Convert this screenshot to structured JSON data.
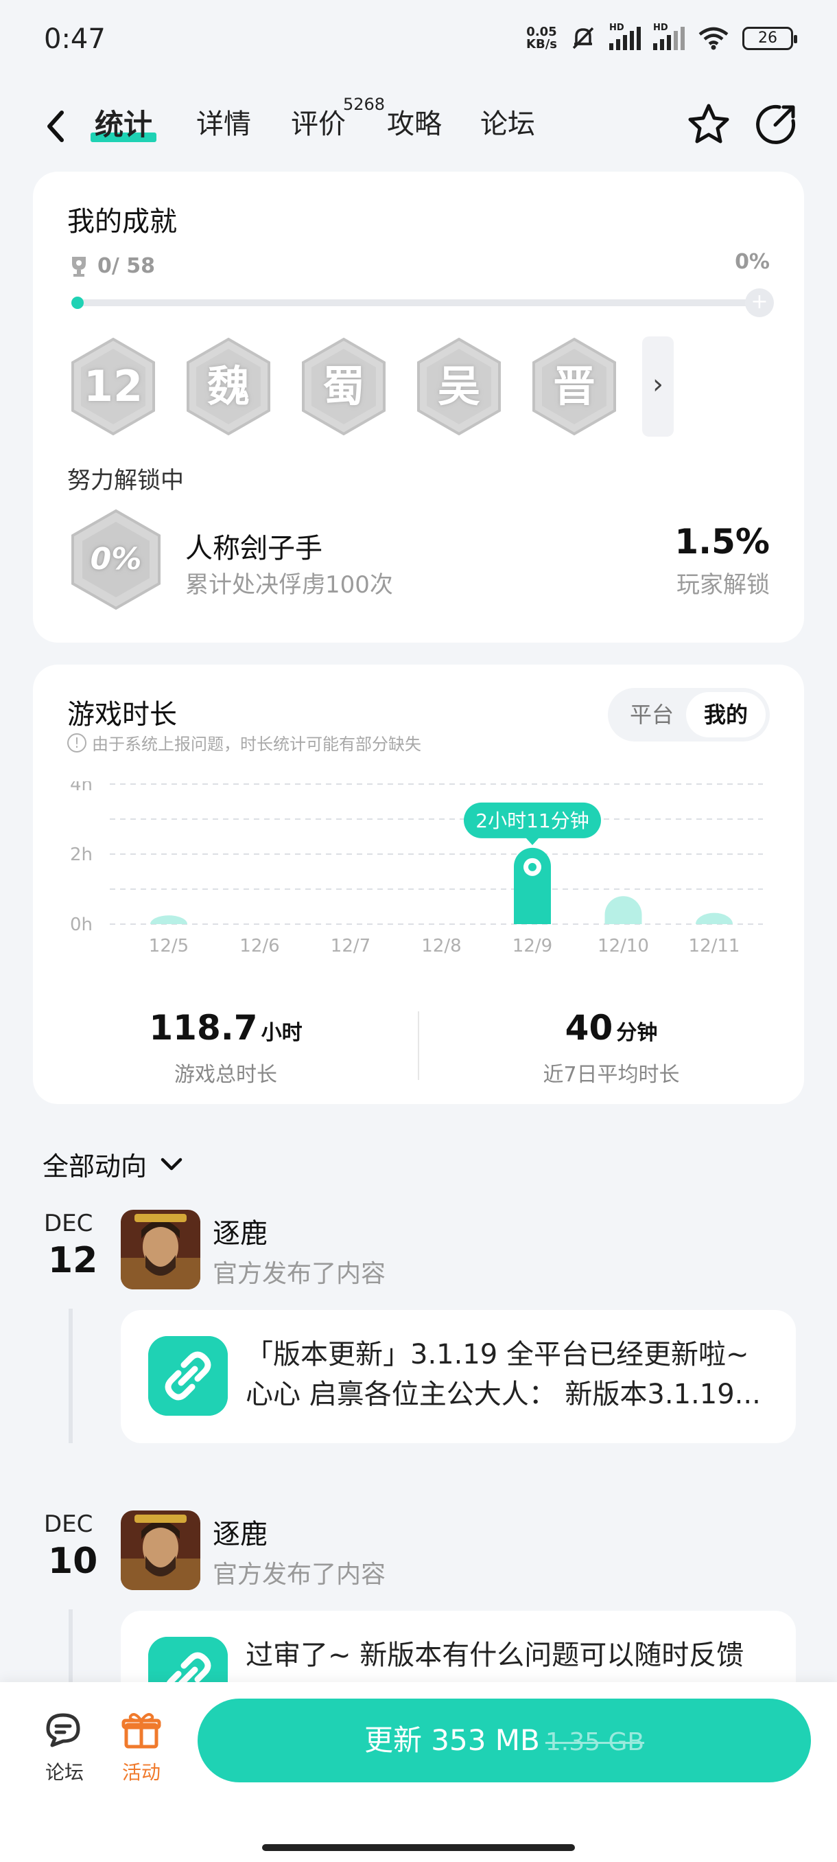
{
  "status_bar": {
    "time": "0:47",
    "net_speed_value": "0.05",
    "net_speed_unit": "KB/s",
    "hd_1": "HD",
    "hd_2": "HD",
    "battery": "26"
  },
  "nav": {
    "tabs": [
      "统计",
      "详情",
      "评价",
      "攻略",
      "论坛"
    ],
    "active_tab": "统计",
    "review_count": "5268",
    "accent": "#1fd2b4"
  },
  "achievements": {
    "title": "我的成就",
    "progress_text": "0/ 58",
    "progress_percent": "0%",
    "progress_fraction": 0,
    "badges": [
      "12",
      "魏",
      "蜀",
      "吴",
      "晋"
    ],
    "unlocking_label": "努力解锁中",
    "current": {
      "badge_text": "0%",
      "name": "人称刽子手",
      "description": "累计处决俘虏100次",
      "percent": "1.5%",
      "percent_label": "玩家解锁"
    }
  },
  "playtime": {
    "title": "游戏时长",
    "notice": "由于系统上报问题，时长统计可能有部分缺失",
    "notice_icon": "!",
    "toggle": [
      "平台",
      "我的"
    ],
    "toggle_selected": "我的",
    "total_value": "118.7",
    "total_unit": "小时",
    "total_label": "游戏总时长",
    "avg_value": "40",
    "avg_unit": "分钟",
    "avg_label": "近7日平均时长"
  },
  "chart_data": {
    "type": "bar",
    "categories": [
      "12/5",
      "12/6",
      "12/7",
      "12/8",
      "12/9",
      "12/10",
      "12/11"
    ],
    "values": [
      0.25,
      0,
      0,
      0,
      2.18,
      0.8,
      0.32
    ],
    "highlight_index": 4,
    "tooltip": "2小时11分钟",
    "yticks": [
      "0h",
      "2h",
      "4h"
    ],
    "ylim": [
      0,
      4
    ],
    "grid": true,
    "colors": {
      "highlight": "#1fd2b4",
      "normal": "#b7f0e6"
    }
  },
  "feed": {
    "filter_label": "全部动向",
    "items": [
      {
        "month": "DEC",
        "day": "12",
        "author": "逐鹿",
        "subtitle": "官方发布了内容",
        "line1": "「版本更新」3.1.19 全平台已经更新啦~",
        "line2": "心心 启禀各位主公大人： 新版本3.1.19..."
      },
      {
        "month": "DEC",
        "day": "10",
        "author": "逐鹿",
        "subtitle": "官方发布了内容",
        "line1": "过审了~ 新版本有什么问题可以随时反馈",
        "line2": ""
      }
    ]
  },
  "bottom": {
    "forum_label": "论坛",
    "activity_label": "活动",
    "update_label": "更新 353 MB",
    "old_size": "1.35 GB"
  }
}
